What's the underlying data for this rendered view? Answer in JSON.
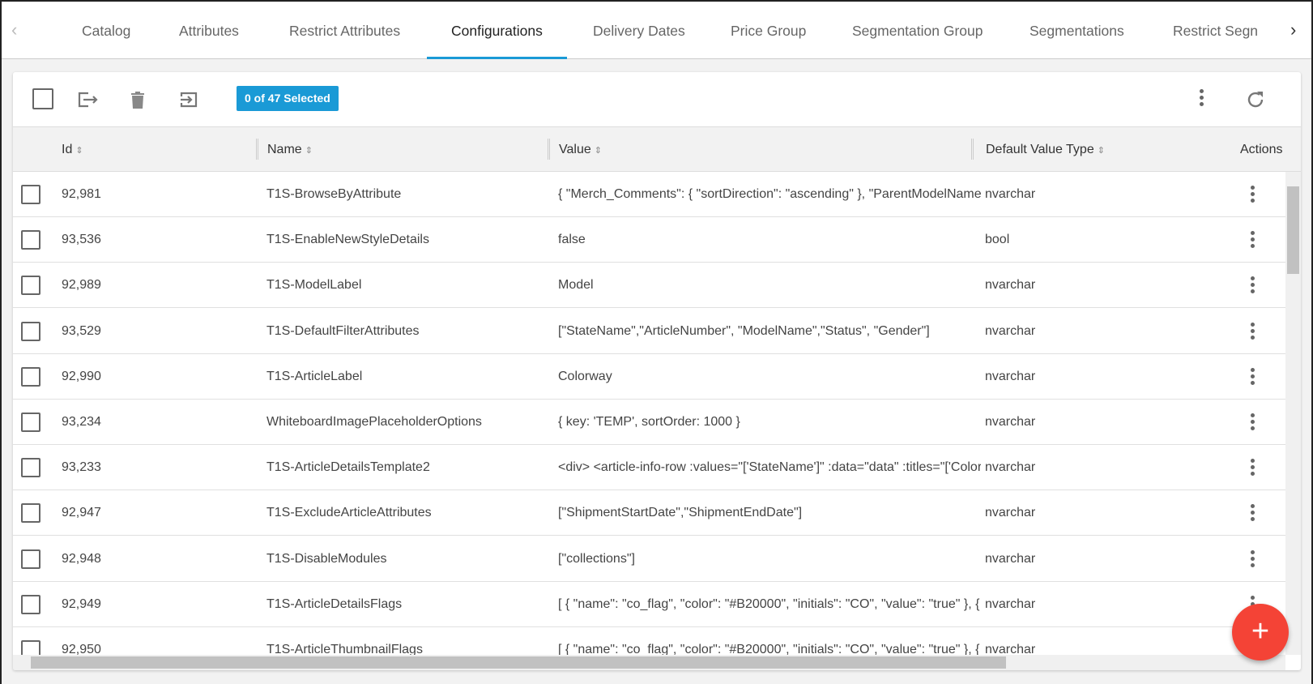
{
  "tabs": {
    "items": [
      "Catalog",
      "Attributes",
      "Restrict Attributes",
      "Configurations",
      "Delivery Dates",
      "Price Group",
      "Segmentation Group",
      "Segmentations",
      "Restrict Segn"
    ],
    "active": "Configurations"
  },
  "toolbar": {
    "selection_badge": "0 of 47 Selected",
    "accent": "#1a9ad6"
  },
  "table": {
    "columns": [
      "Id",
      "Name",
      "Value",
      "Default Value Type",
      "Actions"
    ],
    "rows": [
      {
        "id": "92,981",
        "name": "T1S-BrowseByAttribute",
        "value": "{ \"Merch_Comments\": { \"sortDirection\": \"ascending\" }, \"ParentModelName\"",
        "type": "nvarchar"
      },
      {
        "id": "93,536",
        "name": "T1S-EnableNewStyleDetails",
        "value": "false",
        "type": "bool"
      },
      {
        "id": "92,989",
        "name": "T1S-ModelLabel",
        "value": "Model",
        "type": "nvarchar"
      },
      {
        "id": "93,529",
        "name": "T1S-DefaultFilterAttributes",
        "value": "[\"StateName\",\"ArticleNumber\", \"ModelName\",\"Status\", \"Gender\"]",
        "type": "nvarchar"
      },
      {
        "id": "92,990",
        "name": "T1S-ArticleLabel",
        "value": "Colorway",
        "type": "nvarchar"
      },
      {
        "id": "93,234",
        "name": "WhiteboardImagePlaceholderOptions",
        "value": "{ key: 'TEMP', sortOrder: 1000 }",
        "type": "nvarchar"
      },
      {
        "id": "93,233",
        "name": "T1S-ArticleDetailsTemplate2",
        "value": "<div> <article-info-row :values=\"['StateName']\" :data=\"data\" :titles=\"['Colorw",
        "type": "nvarchar"
      },
      {
        "id": "92,947",
        "name": "T1S-ExcludeArticleAttributes",
        "value": "[\"ShipmentStartDate\",\"ShipmentEndDate\"]",
        "type": "nvarchar"
      },
      {
        "id": "92,948",
        "name": "T1S-DisableModules",
        "value": "[\"collections\"]",
        "type": "nvarchar"
      },
      {
        "id": "92,949",
        "name": "T1S-ArticleDetailsFlags",
        "value": "[ { \"name\": \"co_flag\", \"color\": \"#B20000\", \"initials\": \"CO\", \"value\": \"true\" }, { \"na",
        "type": "nvarchar"
      },
      {
        "id": "92,950",
        "name": "T1S-ArticleThumbnailFlags",
        "value": "[ { \"name\": \"co_flag\", \"color\": \"#B20000\", \"initials\": \"CO\", \"value\": \"true\" }, { \"na",
        "type": "nvarchar"
      }
    ]
  },
  "fab": {
    "label": "+",
    "color": "#f44336"
  }
}
